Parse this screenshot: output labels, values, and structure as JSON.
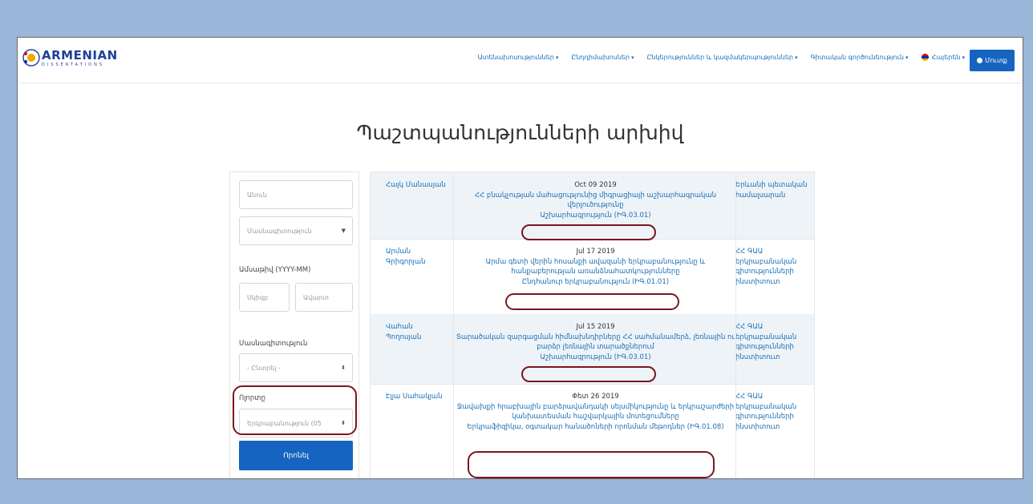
{
  "header": {
    "logo_text": "ARMENIAN",
    "logo_subtext": "DISSERTATIONS",
    "nav": [
      {
        "label": "Ատենախոսություններ"
      },
      {
        "label": "Ընդդիմախոսներ"
      },
      {
        "label": "Ընկերություններ և կազմակերպություններ"
      },
      {
        "label": "Գիտական գործունեություն"
      },
      {
        "label": "Հայերեն"
      }
    ],
    "login_label": "Մուտք"
  },
  "page_title": "Պաշտպանությունների արխիվ",
  "filters": {
    "name_placeholder": "Անուն",
    "specialty_placeholder": "Մասնագիտություն",
    "date_label": "Ամսաթիվ (YYYY-MM)",
    "date_from_placeholder": "Սկիզբ",
    "date_to_placeholder": "Ավարտ",
    "specialty_label": "Մասնագիտություն",
    "specialty_value": "- Ընտրել -",
    "branch_label": "Ոլորտը",
    "branch_value": "Երկրաբանություն (05",
    "submit_label": "Որոնել"
  },
  "colors": {
    "primary": "#1565c0",
    "link": "#1a6fb5",
    "highlight_oval": "#7a1620",
    "outer_background": "#9bb7d9"
  },
  "rows": [
    {
      "author": "Հայկ Մանասյան",
      "date": "Oct 09 2019",
      "title": "ՀՀ բնակչության մահացությունից միգրացիայի աշխարհագրական վերլուծությունը",
      "category": "Աշխարհագրություն (ԻԳ.03.01)",
      "institution": "Երևանի պետական համալսարան"
    },
    {
      "author": "Արման Գրիգորյան",
      "date": "Jul 17 2019",
      "title": "Արմա գետի վերին հոսանքի ավազանի երկրաբանությունը և հանքաբերության առանձնահատկությունները",
      "category": "Ընդհանուր երկրաբանություն (ԻԳ.01.01)",
      "institution": "ՀՀ ԳԱԱ երկրաբանական գիտությունների ինստիտուտ"
    },
    {
      "author": "Վահան Պողոսյան",
      "date": "Jul 15 2019",
      "title": "Տարածական զարգացման հիմնախնդիրները ՀՀ սահմանամերձ, լեռնային ու բարձր լեռնային տարածքներում",
      "category": "Աշխարհագրություն (ԻԳ.03.01)",
      "institution": "ՀՀ ԳԱԱ երկրաբանական գիտությունների ինստիտուտ"
    },
    {
      "author": "Էլյա Սահակյան",
      "date": "Փետ 26 2019",
      "title": "Ջավախքի հրաբխային բարձրավանդակի սեյսմիկությունը և երկրաշարժերի կանխատեսման հաշվարկային մոտեցումները",
      "category": "Երկրաֆիզիկա, օգտակար հանածոների որոնման մեթոդներ (ԻԳ.01.08)",
      "institution": "ՀՀ ԳԱԱ երկրաբանական գիտությունների ինստիտուտ"
    }
  ]
}
